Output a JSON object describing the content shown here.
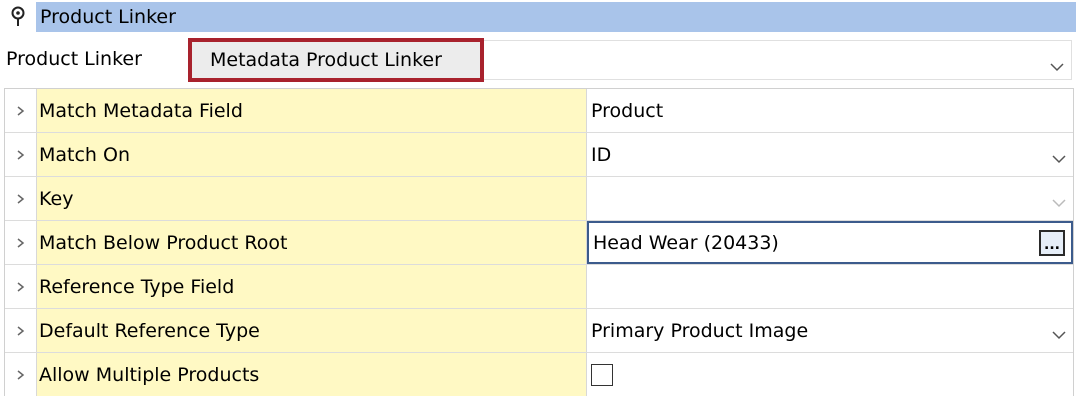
{
  "header": {
    "title": "Product Linker",
    "icon": "pin-icon"
  },
  "linker": {
    "label": "Product Linker",
    "value": "Metadata Product Linker"
  },
  "rows": [
    {
      "name": "Match Metadata Field",
      "value": "Product",
      "control": "text"
    },
    {
      "name": "Match On",
      "value": "ID",
      "control": "dropdown"
    },
    {
      "name": "Key",
      "value": "",
      "control": "dropdown-disabled"
    },
    {
      "name": "Match Below Product Root",
      "value": "Head Wear (20433)",
      "control": "browse",
      "button_label": "..."
    },
    {
      "name": "Reference Type Field",
      "value": "",
      "control": "text"
    },
    {
      "name": "Default Reference Type",
      "value": "Primary Product Image",
      "control": "dropdown"
    },
    {
      "name": "Allow Multiple Products",
      "value": "",
      "control": "checkbox",
      "checked": false
    }
  ],
  "colors": {
    "header_bg": "#a9c4ea",
    "name_cell_bg": "#fff9c4",
    "highlight_border": "#a8222d"
  }
}
